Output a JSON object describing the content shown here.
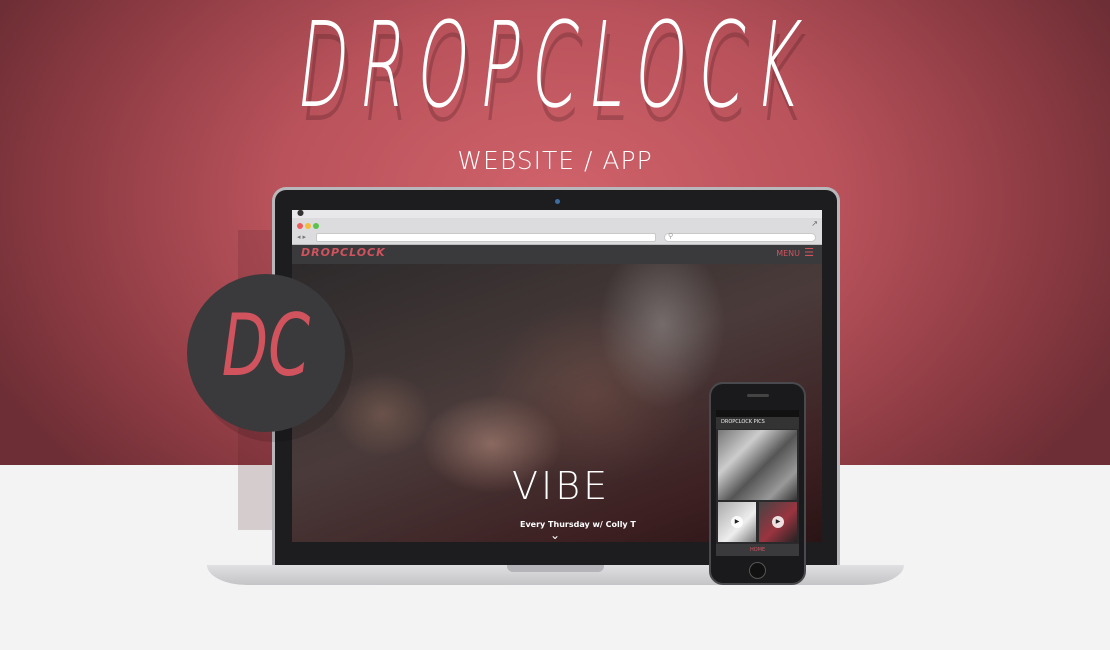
{
  "brand": {
    "title": "DROPCLOCK",
    "subtitle": "WEBSITE / APP",
    "badge": "DC"
  },
  "browser": {
    "url_value": "",
    "search_value": ""
  },
  "website": {
    "logo": "DROPCLOCK",
    "menu_label": "MENU",
    "hero_title": "VIBE",
    "hero_subtitle": "Every Thursday w/ Colly T"
  },
  "phone": {
    "header_label": "DROPCLOCK PICS",
    "tab_label": "HOME"
  },
  "icons": {
    "apple": "apple-icon",
    "menu": "hamburger-menu-icon",
    "chevron": "chevron-down-icon",
    "play": "play-icon",
    "search": "search-icon",
    "expand": "expand-icon"
  },
  "colors": {
    "accent": "#d0535e",
    "background_top": "#b9525b",
    "background_bottom": "#f3f3f3",
    "dark": "#3a3a3c"
  }
}
